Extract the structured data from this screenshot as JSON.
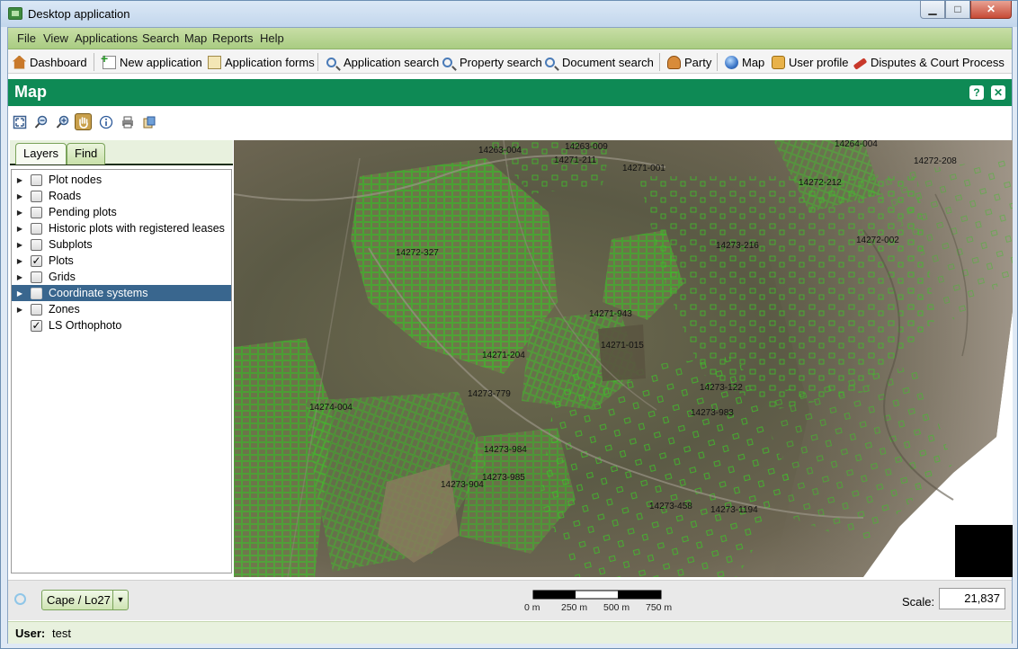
{
  "window": {
    "title": "Desktop application",
    "controls": [
      "▁",
      "□",
      "✕"
    ]
  },
  "menu": [
    "File",
    "View",
    "Applications",
    "Search",
    "Map",
    "Reports",
    "Help"
  ],
  "toolbar": {
    "dashboard": "Dashboard",
    "new_application": "New application",
    "application_forms": "Application forms",
    "application_search": "Application search",
    "property_search": "Property search",
    "document_search": "Document search",
    "party": "Party",
    "map": "Map",
    "user_profile": "User profile",
    "disputes": "Disputes & Court Process"
  },
  "panel": {
    "title": "Map",
    "help": "?",
    "close": "✕"
  },
  "map_tools": [
    "full-extent",
    "zoom-out",
    "zoom-in",
    "pan",
    "identify",
    "print",
    "export"
  ],
  "tabs": [
    "Layers",
    "Find"
  ],
  "layers": [
    {
      "label": "Plot nodes",
      "checked": false,
      "expandable": true
    },
    {
      "label": "Roads",
      "checked": false,
      "expandable": true
    },
    {
      "label": "Pending plots",
      "checked": false,
      "expandable": true
    },
    {
      "label": "Historic plots with registered leases",
      "checked": false,
      "expandable": true
    },
    {
      "label": "Subplots",
      "checked": false,
      "expandable": true
    },
    {
      "label": "Plots",
      "checked": true,
      "expandable": true
    },
    {
      "label": "Grids",
      "checked": false,
      "expandable": true
    },
    {
      "label": "Coordinate systems",
      "checked": false,
      "expandable": true,
      "selected": true
    },
    {
      "label": "Zones",
      "checked": false,
      "expandable": true
    },
    {
      "label": "LS Orthophoto",
      "checked": true,
      "expandable": false
    }
  ],
  "map_labels": [
    "14263-004",
    "14263-009",
    "14271-211",
    "14271-001",
    "14264-004",
    "14272-208",
    "14272-212",
    "14272-327",
    "14273-216",
    "14272-002",
    "14271-943",
    "14271-015",
    "14271-204",
    "14273-779",
    "14274-004",
    "14273-122",
    "14273-983",
    "14273-984",
    "14273-985",
    "14273-904",
    "14273-458",
    "14273-1194"
  ],
  "footer": {
    "crs": "Cape / Lo27",
    "scalebar_ticks": [
      "0 m",
      "250 m",
      "500 m",
      "750 m"
    ],
    "scale_label": "Scale:",
    "scale_value": "21,837"
  },
  "status": {
    "user_label": "User:",
    "user_value": "test"
  },
  "colors": {
    "accent_green": "#0e8a55",
    "menu_green": "#b4d392",
    "plot_outline": "#3fbf2a",
    "selection": "#39668e"
  }
}
